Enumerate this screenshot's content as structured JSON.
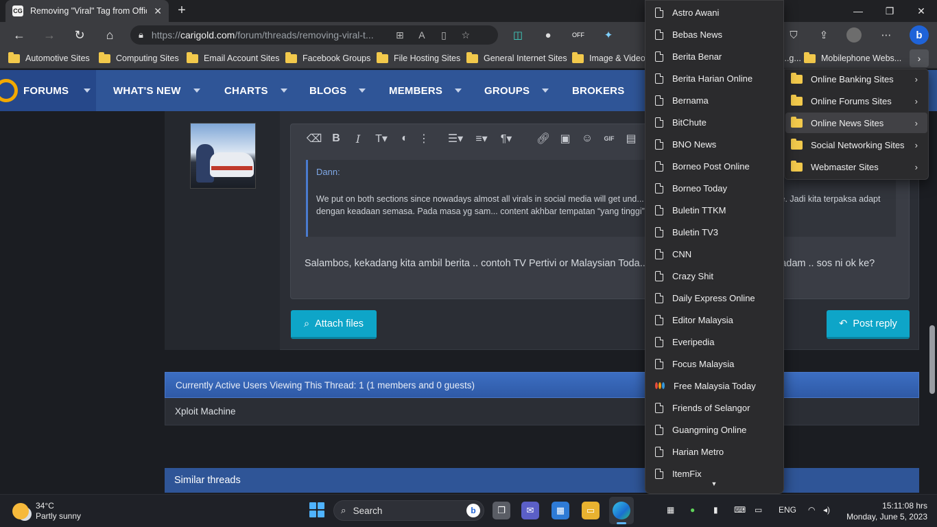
{
  "browser": {
    "tab_title": "Removing \"Viral\" Tag from Officia",
    "tab_favicon": "CG",
    "url_prefix": "https://",
    "url_host": "carigold.com",
    "url_path": "/forum/threads/removing-viral-t..."
  },
  "bookmarks_bar": [
    "Automotive Sites",
    "Computing Sites",
    "Email Account Sites",
    "Facebook Groups",
    "File Hosting Sites",
    "General Internet Sites",
    "Image & Video",
    "...g...",
    "Mobilephone Webs..."
  ],
  "forum_nav": {
    "brand": "FORUMS",
    "items": [
      "WHAT'S NEW",
      "CHARTS",
      "BLOGS",
      "MEMBERS",
      "GROUPS",
      "BROKERS"
    ]
  },
  "post": {
    "quote_author": "Dann:",
    "quote_text": "We put on both sections since nowadays almost all virals in social media will get und... n and get published in their local site.  Jadi kita terpaksa adapt dengan keadaan semasa. Pada masa yg sam... content akhbar tempatan “yang tinggi” melalui prefix VIRAL 😜",
    "reply_text": "Salambos, kekadang kita ambil berita .. contoh TV Pertivi or Malaysian Toda... ...da sedikit thread sudah di padam .. sos ni ok ke?",
    "attach_label": "Attach files",
    "post_reply_label": "Post reply"
  },
  "active_users": {
    "heading": "Currently Active Users Viewing This Thread: 1 (1 members and 0 guests)",
    "users": "Xploit Machine"
  },
  "similar_heading": "Similar threads",
  "news_menu": [
    "Astro Awani",
    "Bebas News",
    "Berita Benar",
    "Berita Harian Online",
    "Bernama",
    "BitChute",
    "BNO News",
    "Borneo Post Online",
    "Borneo Today",
    "Buletin TTKM",
    "Buletin TV3",
    "CNN",
    "Crazy Shit",
    "Daily Express Online",
    "Editor Malaysia",
    "Everipedia",
    "Focus Malaysia",
    "Free Malaysia Today",
    "Friends of Selangor",
    "Guangming Online",
    "Harian Metro",
    "ItemFix"
  ],
  "category_menu": [
    {
      "label": "Online Banking Sites",
      "selected": false
    },
    {
      "label": "Online Forums Sites",
      "selected": false
    },
    {
      "label": "Online News Sites",
      "selected": true
    },
    {
      "label": "Social Networking Sites",
      "selected": false
    },
    {
      "label": "Webmaster Sites",
      "selected": false
    }
  ],
  "taskbar": {
    "temperature": "34°C",
    "weather": "Partly sunny",
    "search_label": "Search",
    "language": "ENG",
    "time": "15:11:08 hrs",
    "date": "Monday, June 5, 2023"
  },
  "colors": {
    "forum_nav": "#2f5597",
    "accent_button": "#0ea5c8",
    "menu_bg": "#2b2b2d",
    "folder": "#f2c94c"
  }
}
